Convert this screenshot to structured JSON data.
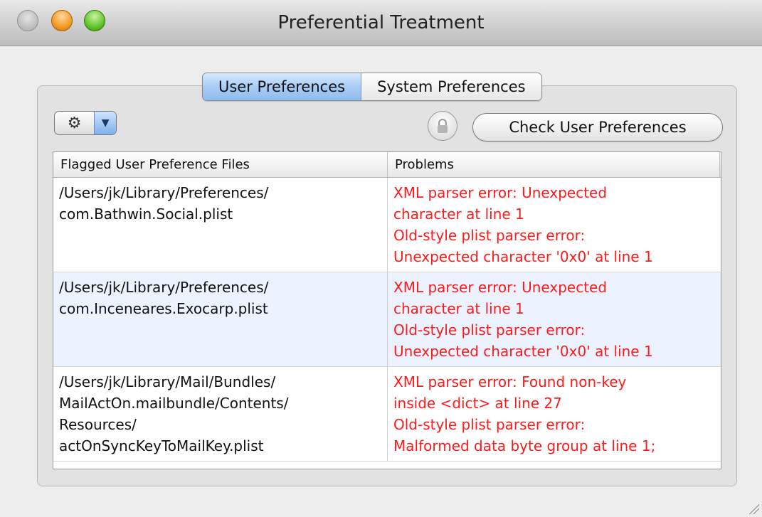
{
  "window": {
    "title": "Preferential Treatment"
  },
  "tabs": [
    {
      "label": "User Preferences",
      "selected": true
    },
    {
      "label": "System Preferences",
      "selected": false
    }
  ],
  "toolbar": {
    "gear_icon": "gear-icon",
    "menu_icon": "chevron-down-icon",
    "lock_icon": "lock-icon",
    "check_button_label": "Check User Preferences"
  },
  "table": {
    "headers": [
      "Flagged User Preference Files",
      "Problems"
    ],
    "rows": [
      {
        "file_lines": [
          "/Users/jk/Library/Preferences/",
          "com.Bathwin.Social.plist"
        ],
        "problem_lines": [
          "XML parser error: Unexpected",
          "character  at line 1",
          "Old-style plist parser error:",
          "Unexpected character '0x0' at line 1"
        ]
      },
      {
        "file_lines": [
          "/Users/jk/Library/Preferences/",
          "com.Inceneares.Exocarp.plist"
        ],
        "problem_lines": [
          "XML parser error: Unexpected",
          "character  at line 1",
          "Old-style plist parser error:",
          "Unexpected character '0x0' at line 1"
        ]
      },
      {
        "file_lines": [
          "/Users/jk/Library/Mail/Bundles/",
          "MailActOn.mailbundle/Contents/",
          "Resources/",
          "actOnSyncKeyToMailKey.plist"
        ],
        "problem_lines": [
          "XML parser error: Found non-key",
          "inside <dict> at line 27",
          "Old-style plist parser error:",
          "Malformed data byte group at line 1;"
        ]
      }
    ]
  },
  "colors": {
    "error_text": "#ff1a1a",
    "selected_tab": "#a9ccf6",
    "alt_row": "#edf3fe"
  }
}
